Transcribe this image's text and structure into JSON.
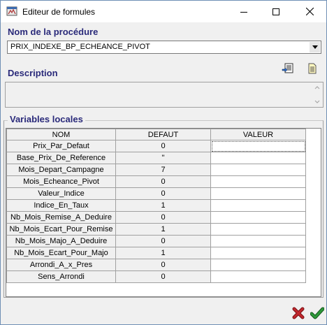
{
  "window": {
    "title": "Editeur de formules",
    "icon": "formula-editor-app-icon",
    "controls": [
      "minimize-icon",
      "maximize-icon",
      "close-icon"
    ]
  },
  "procedure": {
    "label": "Nom de la procédure",
    "selected": "PRIX_INDEXE_BP_ECHEANCE_PIVOT"
  },
  "description": {
    "label": "Description",
    "value": "",
    "toolbar_icons": [
      "import-document-icon",
      "document-icon"
    ]
  },
  "variables": {
    "label": "Variables locales",
    "columns": [
      "NOM",
      "DEFAUT",
      "VALEUR"
    ],
    "rows": [
      {
        "nom": "Prix_Par_Defaut",
        "defaut": "0",
        "valeur": ""
      },
      {
        "nom": "Base_Prix_De_Reference",
        "defaut": "''",
        "valeur": ""
      },
      {
        "nom": "Mois_Depart_Campagne",
        "defaut": "7",
        "valeur": ""
      },
      {
        "nom": "Mois_Echeance_Pivot",
        "defaut": "0",
        "valeur": ""
      },
      {
        "nom": "Valeur_Indice",
        "defaut": "0",
        "valeur": ""
      },
      {
        "nom": "Indice_En_Taux",
        "defaut": "1",
        "valeur": ""
      },
      {
        "nom": "Nb_Mois_Remise_A_Deduire",
        "defaut": "0",
        "valeur": ""
      },
      {
        "nom": "Nb_Mois_Ecart_Pour_Remise",
        "defaut": "1",
        "valeur": ""
      },
      {
        "nom": "Nb_Mois_Majo_A_Deduire",
        "defaut": "0",
        "valeur": ""
      },
      {
        "nom": "Nb_Mois_Ecart_Pour_Majo",
        "defaut": "1",
        "valeur": ""
      },
      {
        "nom": "Arrondi_A_x_Pres",
        "defaut": "0",
        "valeur": ""
      },
      {
        "nom": "Sens_Arrondi",
        "defaut": "0",
        "valeur": ""
      }
    ]
  },
  "actions": {
    "cancel_icon": "red-x-cancel-icon",
    "ok_icon": "green-check-ok-icon"
  },
  "colors": {
    "section_label": "#2a2a7a",
    "cancel": "#c0282d",
    "ok": "#2e9a3a"
  }
}
